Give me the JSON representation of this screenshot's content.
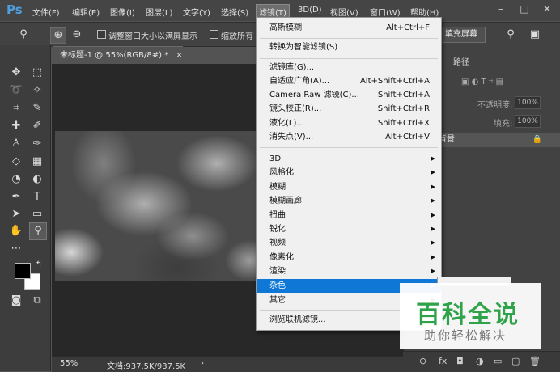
{
  "app": {
    "logo": "Ps"
  },
  "menubar": {
    "items": [
      "文件(F)",
      "编辑(E)",
      "图像(I)",
      "图层(L)",
      "文字(Y)",
      "选择(S)",
      "滤镜(T)",
      "3D(D)",
      "视图(V)",
      "窗口(W)",
      "帮助(H)"
    ],
    "active": "滤镜(T)"
  },
  "window_controls": {
    "minimize": "–",
    "maximize": "□",
    "close": "✕"
  },
  "options": {
    "resize_windows_label": "调整窗口大小以满屏显示",
    "zoom_all_label": "缩放所有",
    "fill_screen_label": "填充屏幕"
  },
  "document": {
    "tab_title": "未标题-1 @ 55%(RGB/8#) *",
    "tab_close": "×",
    "zoom": "55%",
    "doc_size": "文档:937.5K/937.5K"
  },
  "layers_panel": {
    "tab_paths": "路径",
    "opacity_label": "不透明度:",
    "opacity_value": "100%",
    "fill_label": "填充:",
    "fill_value": "100%",
    "layer_name": "背景"
  },
  "filter_menu": {
    "items": [
      {
        "label": "高斯模糊",
        "shortcut": "Alt+Ctrl+F"
      },
      {
        "label": "转换为智能滤镜(S)",
        "shortcut": ""
      },
      {
        "label": "滤镜库(G)...",
        "shortcut": ""
      },
      {
        "label": "自适应广角(A)...",
        "shortcut": "Alt+Shift+Ctrl+A"
      },
      {
        "label": "Camera Raw 滤镜(C)...",
        "shortcut": "Shift+Ctrl+A"
      },
      {
        "label": "镜头校正(R)...",
        "shortcut": "Shift+Ctrl+R"
      },
      {
        "label": "液化(L)...",
        "shortcut": "Shift+Ctrl+X"
      },
      {
        "label": "消失点(V)...",
        "shortcut": "Alt+Ctrl+V"
      },
      {
        "label": "3D",
        "submenu": true
      },
      {
        "label": "风格化",
        "submenu": true
      },
      {
        "label": "模糊",
        "submenu": true
      },
      {
        "label": "模糊画廊",
        "submenu": true
      },
      {
        "label": "扭曲",
        "submenu": true
      },
      {
        "label": "锐化",
        "submenu": true
      },
      {
        "label": "视频",
        "submenu": true
      },
      {
        "label": "像素化",
        "submenu": true
      },
      {
        "label": "渲染",
        "submenu": true
      },
      {
        "label": "杂色",
        "submenu": true,
        "highlighted": true
      },
      {
        "label": "其它",
        "submenu": true
      },
      {
        "label": "浏览联机滤镜...",
        "shortcut": ""
      }
    ]
  },
  "watermark": {
    "title": "百科全说",
    "subtitle": "助你轻松解决",
    "color": "#2fa34a"
  },
  "colors": {
    "highlight": "#0f78d7",
    "foreground": "#000000",
    "background": "#ffffff"
  }
}
